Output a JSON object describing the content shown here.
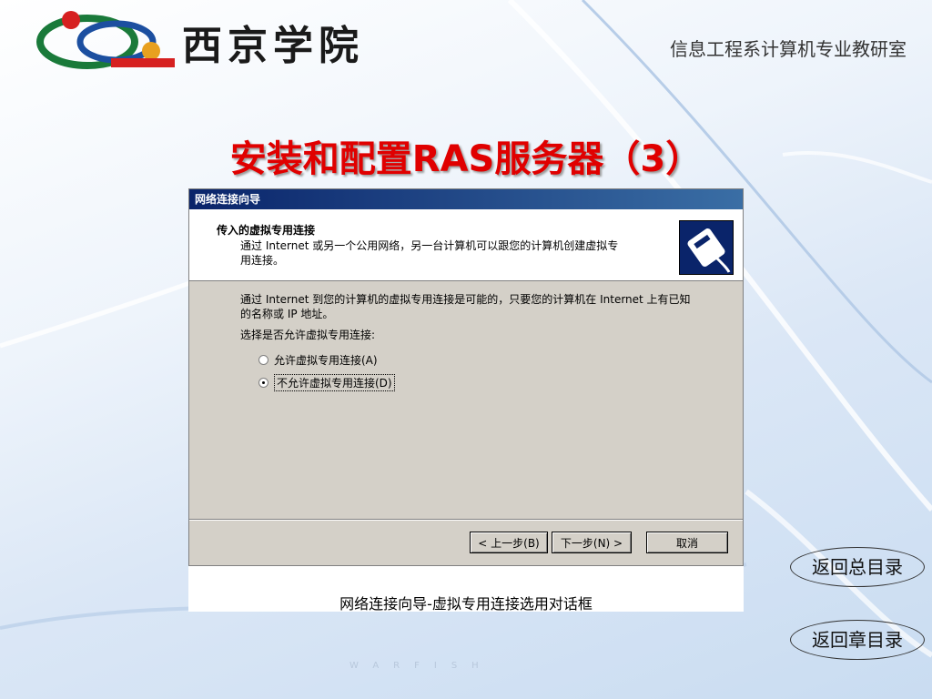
{
  "header": {
    "school_name": "西京学院",
    "department": "信息工程系计算机专业教研室"
  },
  "slide": {
    "title": "安装和配置RAS服务器（3）",
    "caption": "网络连接向导-虚拟专用连接选用对话框"
  },
  "dialog": {
    "window_title": "网络连接向导",
    "header_title": "传入的虚拟专用连接",
    "header_desc": "通过 Internet  或另一个公用网络，另一台计算机可以跟您的计算机创建虚拟专用连接。",
    "intro": "通过 Internet 到您的计算机的虚拟专用连接是可能的，只要您的计算机在 Internet 上有已知的名称或 IP 地址。",
    "choose_label": "选择是否允许虚拟专用连接:",
    "options": [
      {
        "label": "允许虚拟专用连接(A)",
        "selected": false
      },
      {
        "label": "不允许虚拟专用连接(D)",
        "selected": true
      }
    ],
    "buttons": {
      "back": "< 上一步(B)",
      "next": "下一步(N) >",
      "cancel": "取消"
    }
  },
  "nav": {
    "back_to_main": "返回总目录",
    "back_to_chapter": "返回章目录"
  },
  "watermark": "WARFISH",
  "colors": {
    "title_red": "#e00000",
    "titlebar_blue": "#0a246a"
  }
}
